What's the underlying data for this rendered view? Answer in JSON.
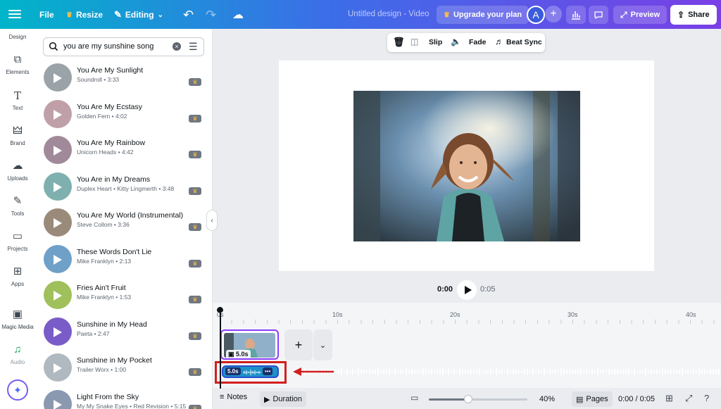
{
  "topbar": {
    "file_label": "File",
    "resize_label": "Resize",
    "editing_label": "Editing",
    "doc_title": "Untitled design - Video",
    "upgrade_label": "Upgrade your plan",
    "avatar_letter": "A",
    "preview_label": "Preview",
    "share_label": "Share"
  },
  "rail": {
    "items": [
      {
        "label": "Design",
        "icon": "design-icon"
      },
      {
        "label": "Elements",
        "icon": "elements-icon"
      },
      {
        "label": "Text",
        "icon": "text-icon"
      },
      {
        "label": "Brand",
        "icon": "brand-icon"
      },
      {
        "label": "Uploads",
        "icon": "uploads-icon"
      },
      {
        "label": "Tools",
        "icon": "tools-icon"
      },
      {
        "label": "Projects",
        "icon": "projects-icon"
      },
      {
        "label": "Apps",
        "icon": "apps-icon"
      },
      {
        "label": "Magic Media",
        "icon": "magic-media-icon"
      },
      {
        "label": "Audio",
        "icon": "audio-icon"
      }
    ]
  },
  "search": {
    "value": "you are my sunshine song"
  },
  "tracks": [
    {
      "title": "You Are My Sunlight",
      "meta": "Soundroll • 3:33"
    },
    {
      "title": "You Are My Ecstasy",
      "meta": "Golden Fern • 4:02"
    },
    {
      "title": "You Are My Rainbow",
      "meta": "Unicorn Heads • 4:42"
    },
    {
      "title": "You Are in My Dreams",
      "meta": "Duplex Heart • Kitty Lingmerth • 3:48"
    },
    {
      "title": "You Are My World (Instrumental)",
      "meta": "Steve Collom • 3:36"
    },
    {
      "title": "These Words Don't Lie",
      "meta": "Mike Franklyn • 2:13"
    },
    {
      "title": "Fries Ain't Fruit",
      "meta": "Mike Franklyn • 1:53"
    },
    {
      "title": "Sunshine in My Head",
      "meta": "Paeta • 2:47"
    },
    {
      "title": "Sunshine in My Pocket",
      "meta": "Trailer Worx • 1:00"
    },
    {
      "title": "Light From the Sky",
      "meta": "My My Snake Eyes • Red Revision • 5:15"
    }
  ],
  "context_bar": {
    "slip_label": "Slip",
    "fade_label": "Fade",
    "beat_sync_label": "Beat Sync"
  },
  "player": {
    "current_time": "0:00",
    "total_time": "0:05"
  },
  "timeline": {
    "ticks": [
      "0s",
      "10s",
      "20s",
      "30s",
      "40s"
    ],
    "clip_duration": "5.0s",
    "audio_duration": "5.0s",
    "audio_more": "•••"
  },
  "bottombar": {
    "notes_label": "Notes",
    "duration_label": "Duration",
    "zoom_level": "40%",
    "zoom_fraction": 0.4,
    "pages_label": "Pages",
    "time_readout": "0:00 / 0:05"
  },
  "colors": {
    "accent": "#8b3dff",
    "annotation_red": "#d21f1f",
    "audio_blue": "#1e90c8"
  }
}
